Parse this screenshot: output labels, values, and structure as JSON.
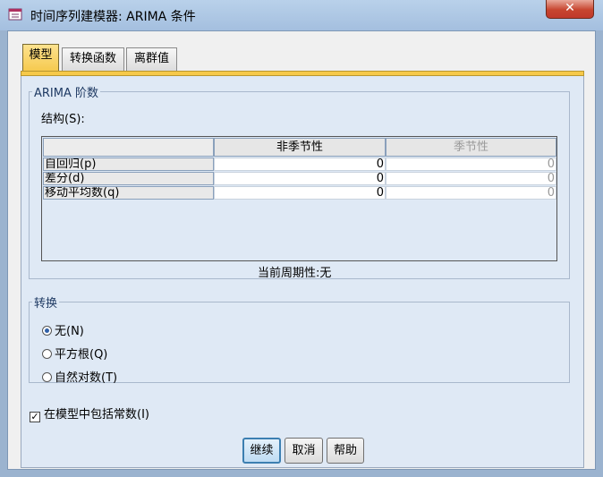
{
  "window": {
    "title": "时间序列建模器: ARIMA 条件",
    "close_glyph": "✕",
    "icon": "app-window-icon"
  },
  "tabs": [
    {
      "label": "模型",
      "active": true
    },
    {
      "label": "转换函数",
      "active": false
    },
    {
      "label": "离群值",
      "active": false
    }
  ],
  "arima_group": {
    "legend": "ARIMA 阶数",
    "structure_label": "结构(S):",
    "columns": [
      "非季节性",
      "季节性"
    ],
    "rows": [
      {
        "label": "自回归(p)",
        "nonseasonal": "0",
        "seasonal": "0"
      },
      {
        "label": "差分(d)",
        "nonseasonal": "0",
        "seasonal": "0"
      },
      {
        "label": "移动平均数(q)",
        "nonseasonal": "0",
        "seasonal": "0"
      }
    ],
    "period_text": "当前周期性:无"
  },
  "transform_group": {
    "legend": "转换",
    "options": [
      {
        "label": "无(N)",
        "selected": true
      },
      {
        "label": "平方根(Q)",
        "selected": false
      },
      {
        "label": "自然对数(T)",
        "selected": false
      }
    ]
  },
  "include_constant": {
    "label": "在模型中包括常数(I)",
    "checked": true,
    "glyph": "✓"
  },
  "buttons": {
    "continue": "继续",
    "cancel": "取消",
    "help": "帮助"
  }
}
